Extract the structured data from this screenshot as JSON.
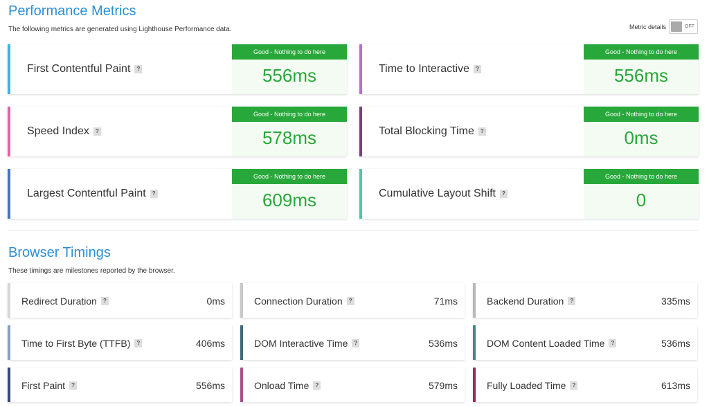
{
  "performance": {
    "title": "Performance Metrics",
    "subtitle": "The following metrics are generated using Lighthouse Performance data.",
    "toggle_label": "Metric details",
    "toggle_state": "OFF",
    "metrics": [
      {
        "name": "First Contentful Paint",
        "badge": "Good - Nothing to do here",
        "value": "556ms",
        "accent": "#3cb4e6"
      },
      {
        "name": "Time to Interactive",
        "badge": "Good - Nothing to do here",
        "value": "556ms",
        "accent": "#b36fd3"
      },
      {
        "name": "Speed Index",
        "badge": "Good - Nothing to do here",
        "value": "578ms",
        "accent": "#e065a3"
      },
      {
        "name": "Total Blocking Time",
        "badge": "Good - Nothing to do here",
        "value": "0ms",
        "accent": "#7a3f7e"
      },
      {
        "name": "Largest Contentful Paint",
        "badge": "Good - Nothing to do here",
        "value": "609ms",
        "accent": "#4a72c4"
      },
      {
        "name": "Cumulative Layout Shift",
        "badge": "Good - Nothing to do here",
        "value": "0",
        "accent": "#4fc9a4"
      }
    ],
    "help_icon": "?"
  },
  "browser": {
    "title": "Browser Timings",
    "subtitle": "These timings are milestones reported by the browser.",
    "timings": [
      {
        "name": "Redirect Duration",
        "value": "0ms",
        "accent": "#d8d8d8"
      },
      {
        "name": "Connection Duration",
        "value": "71ms",
        "accent": "#c8c8c8"
      },
      {
        "name": "Backend Duration",
        "value": "335ms",
        "accent": "#b8b8b8"
      },
      {
        "name": "Time to First Byte (TTFB)",
        "value": "406ms",
        "accent": "#8b9fc4"
      },
      {
        "name": "DOM Interactive Time",
        "value": "536ms",
        "accent": "#3f6b78"
      },
      {
        "name": "DOM Content Loaded Time",
        "value": "536ms",
        "accent": "#3f8a8a"
      },
      {
        "name": "First Paint",
        "value": "556ms",
        "accent": "#3a4a78"
      },
      {
        "name": "Onload Time",
        "value": "579ms",
        "accent": "#a05588"
      },
      {
        "name": "Fully Loaded Time",
        "value": "613ms",
        "accent": "#9b2a5e"
      }
    ],
    "help_icon": "?"
  }
}
